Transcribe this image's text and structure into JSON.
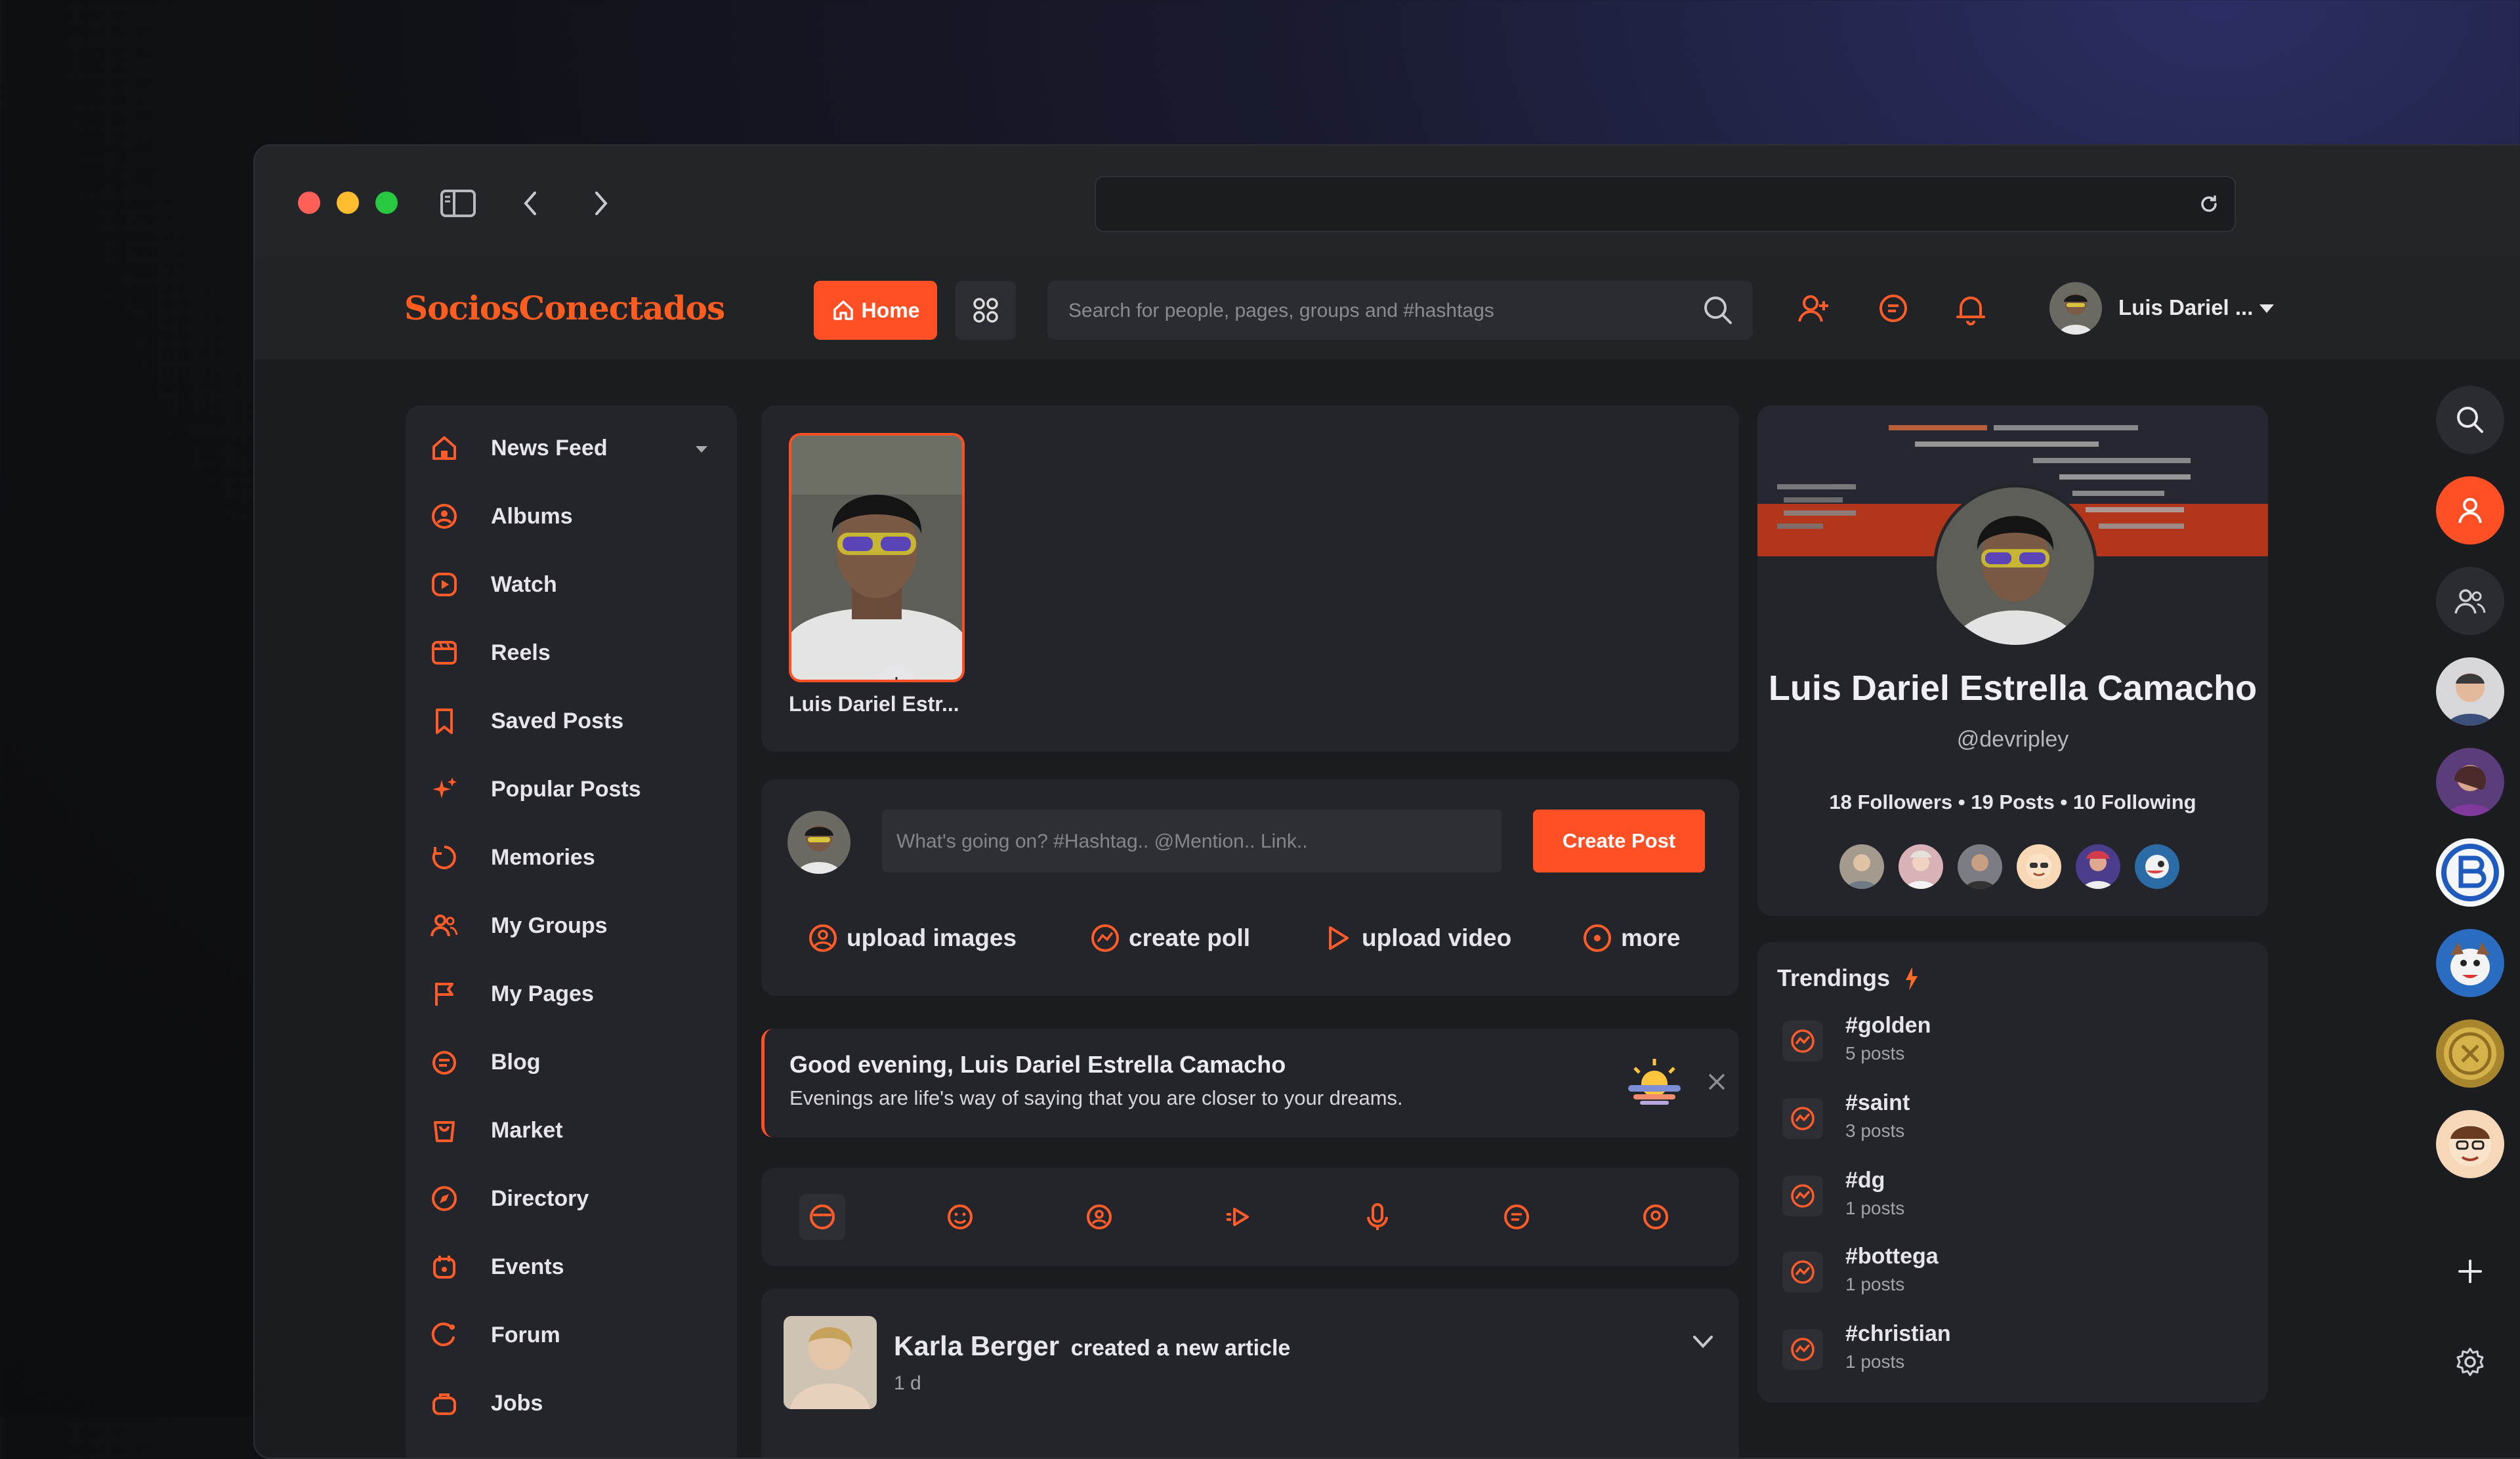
{
  "browser": {
    "url": ""
  },
  "app": {
    "logo": "SociosConectados",
    "home_label": "Home",
    "search_placeholder": "Search for people, pages, groups and #hashtags",
    "user_name": "Luis Dariel ..."
  },
  "sidebar": {
    "items": [
      {
        "label": "News Feed",
        "icon": "home-icon"
      },
      {
        "label": "Albums",
        "icon": "album-icon"
      },
      {
        "label": "Watch",
        "icon": "play-icon"
      },
      {
        "label": "Reels",
        "icon": "reels-icon"
      },
      {
        "label": "Saved Posts",
        "icon": "bookmark-icon"
      },
      {
        "label": "Popular Posts",
        "icon": "sparkle-icon"
      },
      {
        "label": "Memories",
        "icon": "memories-icon"
      },
      {
        "label": "My Groups",
        "icon": "groups-icon"
      },
      {
        "label": "My Pages",
        "icon": "flag-icon"
      },
      {
        "label": "Blog",
        "icon": "blog-icon"
      },
      {
        "label": "Market",
        "icon": "market-icon"
      },
      {
        "label": "Directory",
        "icon": "compass-icon"
      },
      {
        "label": "Events",
        "icon": "calendar-icon"
      },
      {
        "label": "Forum",
        "icon": "forum-icon"
      },
      {
        "label": "Jobs",
        "icon": "jobs-icon"
      }
    ]
  },
  "story": {
    "name": "Luis Dariel Estr..."
  },
  "composer": {
    "placeholder": "What's going on? #Hashtag.. @Mention.. Link..",
    "create_label": "Create Post",
    "actions": {
      "upload_images": "upload images",
      "create_poll": "create poll",
      "upload_video": "upload video",
      "more": "more"
    }
  },
  "greeting": {
    "title": "Good evening, Luis Dariel Estrella Camacho",
    "message": "Evenings are life's way of saying that you are closer to your dreams."
  },
  "post": {
    "author": "Karla Berger",
    "action": "created a new article",
    "time": "1 d"
  },
  "profile": {
    "name": "Luis Dariel Estrella Camacho",
    "handle": "@devripley",
    "followers": "18 Followers",
    "posts": "19 Posts",
    "following": "10 Following",
    "separator": "•"
  },
  "trendings": {
    "title": "Trendings",
    "items": [
      {
        "tag": "#golden",
        "count": "5 posts"
      },
      {
        "tag": "#saint",
        "count": "3 posts"
      },
      {
        "tag": "#dg",
        "count": "1 posts"
      },
      {
        "tag": "#bottega",
        "count": "1 posts"
      },
      {
        "tag": "#christian",
        "count": "1 posts"
      }
    ]
  },
  "colors": {
    "accent": "#ff4f24",
    "background": "#1b1c20",
    "panel": "#24252a"
  }
}
